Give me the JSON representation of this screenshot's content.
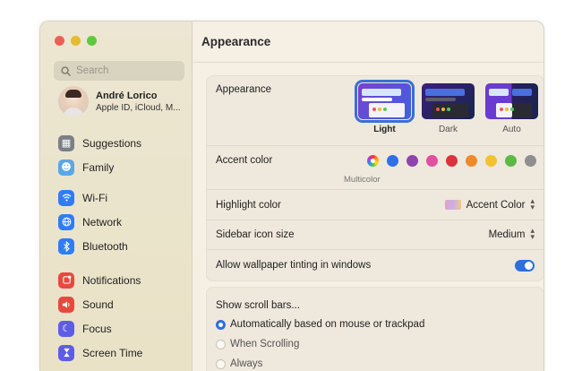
{
  "sidebar": {
    "search_placeholder": "Search",
    "profile": {
      "name": "André Lorico",
      "subtitle": "Apple ID, iCloud, M..."
    },
    "groups": [
      [
        {
          "label": "Suggestions",
          "icon": "suggestions-icon",
          "color": "#7b7f86"
        },
        {
          "label": "Family",
          "icon": "family-icon",
          "color": "#5aa7e8"
        }
      ],
      [
        {
          "label": "Wi-Fi",
          "icon": "wifi-icon",
          "color": "#2f7cf6"
        },
        {
          "label": "Network",
          "icon": "globe-icon",
          "color": "#2f7cf6"
        },
        {
          "label": "Bluetooth",
          "icon": "bluetooth-icon",
          "color": "#2f7cf6"
        }
      ],
      [
        {
          "label": "Notifications",
          "icon": "bell-icon",
          "color": "#e8493f"
        },
        {
          "label": "Sound",
          "icon": "speaker-icon",
          "color": "#e8493f"
        },
        {
          "label": "Focus",
          "icon": "moon-icon",
          "color": "#5e5ce6"
        },
        {
          "label": "Screen Time",
          "icon": "hourglass-icon",
          "color": "#5e5ce6"
        }
      ]
    ]
  },
  "main": {
    "title": "Appearance",
    "appearance": {
      "label": "Appearance",
      "options": [
        {
          "caption": "Light",
          "selected": true
        },
        {
          "caption": "Dark",
          "selected": false
        },
        {
          "caption": "Auto",
          "selected": false
        }
      ]
    },
    "accent": {
      "label": "Accent color",
      "selected_caption": "Multicolor",
      "colors": [
        "#2f6fe8",
        "#8e44ad",
        "#e04fa0",
        "#d9343c",
        "#ec8a2c",
        "#f2c233",
        "#5cb946",
        "#8f8f8f"
      ]
    },
    "highlight": {
      "label": "Highlight color",
      "value": "Accent Color"
    },
    "icon_size": {
      "label": "Sidebar icon size",
      "value": "Medium"
    },
    "tinting": {
      "label": "Allow wallpaper tinting in windows",
      "on": true
    },
    "scroll": {
      "label": "Show scroll bars...",
      "options": [
        {
          "label": "Automatically based on mouse or trackpad",
          "selected": true
        },
        {
          "label": "When Scrolling",
          "selected": false
        },
        {
          "label": "Always",
          "selected": false
        }
      ]
    }
  }
}
